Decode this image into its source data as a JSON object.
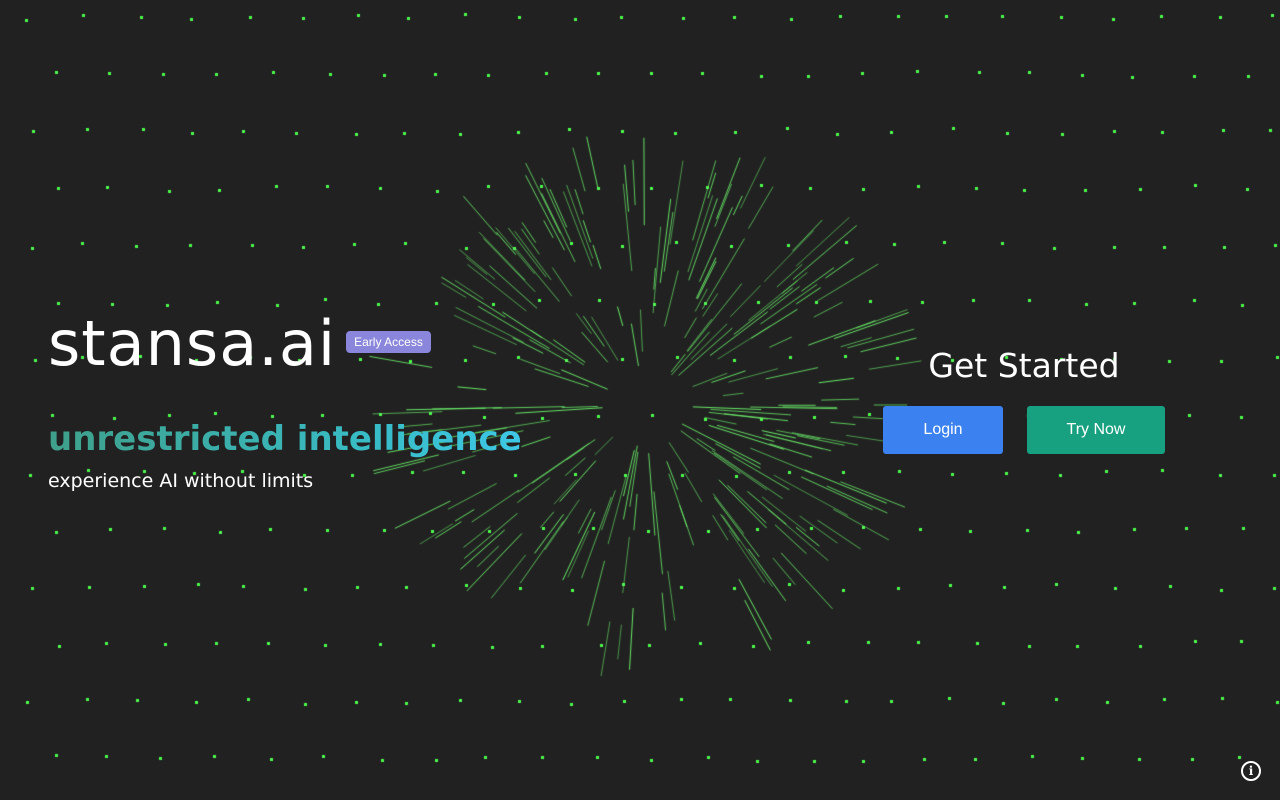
{
  "brand": {
    "title": "stansa.ai",
    "badge": "Early Access"
  },
  "hero": {
    "tagline": "unrestricted intelligence",
    "subline": "experience AI without limits"
  },
  "cta": {
    "heading": "Get Started",
    "login_label": "Login",
    "try_label": "Try Now"
  },
  "footer": {
    "info_icon": "info-icon",
    "info_glyph": "i"
  },
  "colors": {
    "background": "#212121",
    "particle": "#4dff4d",
    "streak": "#6bef6b",
    "login": "#3b82f0",
    "try_now": "#17a180",
    "badge": "#8a86db"
  }
}
